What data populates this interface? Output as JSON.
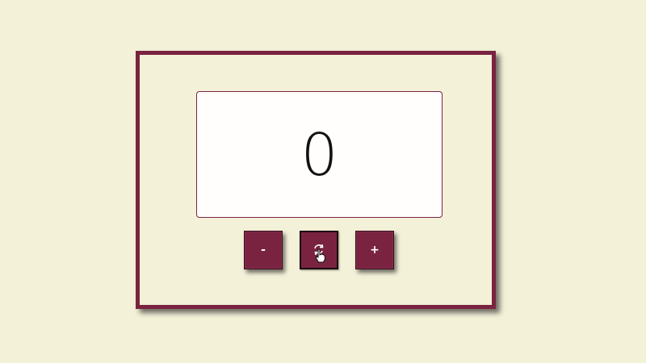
{
  "counter": {
    "value": "0"
  },
  "buttons": {
    "decrement_label": "-",
    "increment_label": "+",
    "reset_icon": "refresh-icon"
  },
  "colors": {
    "background": "#f3f1d8",
    "accent": "#7a2341",
    "display": "#fffefd"
  }
}
